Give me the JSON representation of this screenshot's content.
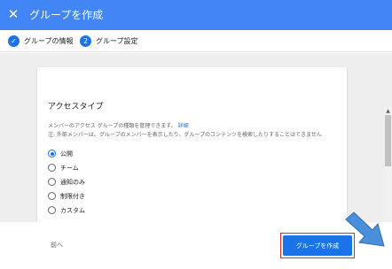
{
  "header": {
    "title": "グループを作成",
    "close_icon": "close-icon"
  },
  "stepper": {
    "steps": [
      {
        "label": "グループの情報",
        "state": "completed",
        "marker": "✓"
      },
      {
        "label": "グループ設定",
        "state": "current",
        "marker": "2"
      }
    ]
  },
  "access": {
    "title": "アクセスタイプ",
    "description": "メンバーのアクセス グループの種類を管理できます。",
    "link": "詳細",
    "note": "注: 外部メンバーは、グループのメンバーを表示したり、グループのコンテンツを検索したりすることはできません",
    "options": [
      {
        "label": "公開",
        "selected": true
      },
      {
        "label": "チーム",
        "selected": false
      },
      {
        "label": "通知のみ",
        "selected": false
      },
      {
        "label": "制限付き",
        "selected": false
      },
      {
        "label": "カスタム",
        "selected": false
      }
    ]
  },
  "footer": {
    "back_label": "前へ",
    "create_label": "グループを作成"
  },
  "colors": {
    "header_bg": "#4285f4",
    "accent": "#1a73e8",
    "highlight_border": "#d32f2f",
    "annotation_arrow": "#4a8fd9"
  }
}
